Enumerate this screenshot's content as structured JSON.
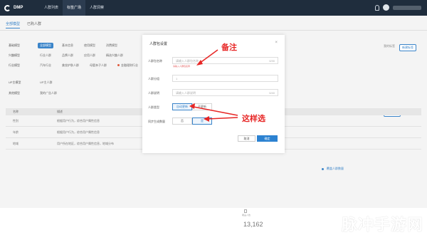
{
  "app": {
    "logo_text": "DMP"
  },
  "nav": [
    "人群列表",
    "标签广场",
    "人群洞察"
  ],
  "tabs": [
    "全部模型",
    "已购人群"
  ],
  "filters": [
    {
      "label": "基础模型",
      "items": [
        "全部模型",
        "基本信息",
        "使用模型",
        "消费模型"
      ]
    },
    {
      "label": "兴趣模型",
      "items": [
        "行业人群",
        "品牌人群",
        "应用人群",
        "精选兴趣人群"
      ]
    },
    {
      "label": "行业模型",
      "items": [
        "汽车行业",
        "美妆护肤人群",
        "母婴亲子人群",
        "金融理财行业"
      ]
    },
    {
      "label": "UP主模型",
      "items": [
        "UP主人群"
      ]
    },
    {
      "label": "其他模型",
      "items": [
        "我的广告人群"
      ]
    }
  ],
  "right_controls": {
    "btn1": "我的标签",
    "btn2": "新建标签"
  },
  "right_controls2": {
    "btn1": "新建标签",
    "btn2": "标签配置"
  },
  "table": {
    "headers": [
      "名称",
      "描述"
    ],
    "rows": [
      [
        "性别",
        "根据用户行为，综合用户属性信息"
      ],
      [
        "年龄",
        "根据用户行为，综合用户属性信息"
      ],
      [
        "地域",
        "用户所在地区，综合用户属性信息，地域分布"
      ]
    ]
  },
  "legend": "覆盖人群数量",
  "footer": {
    "label": "覆盖人数",
    "value": "13,162"
  },
  "watermark": "脉冲手游网",
  "modal": {
    "title": "人群包设置",
    "close": "×",
    "fields": [
      {
        "label": "人群包名称",
        "placeholder": "请输入人群包名称",
        "suffix": "0/30"
      },
      {
        "label": "人群分组",
        "value": "1"
      },
      {
        "label": "人群说明",
        "placeholder": "请输入人群说明",
        "suffix": "0/40"
      }
    ],
    "note": "请输入人群包名称",
    "type_label": "人群类型",
    "type_options": [
      "自动更新",
      "不更新"
    ],
    "gen_label": "同步生成数量",
    "gen_options": [
      "否",
      "是"
    ],
    "cancel": "取消",
    "confirm": "确定"
  },
  "annotations": {
    "note": "备注",
    "select": "这样选"
  },
  "colors": {
    "accent": "#3a84c9",
    "annotation": "#e72625",
    "topbar": "#1f2d3d"
  }
}
